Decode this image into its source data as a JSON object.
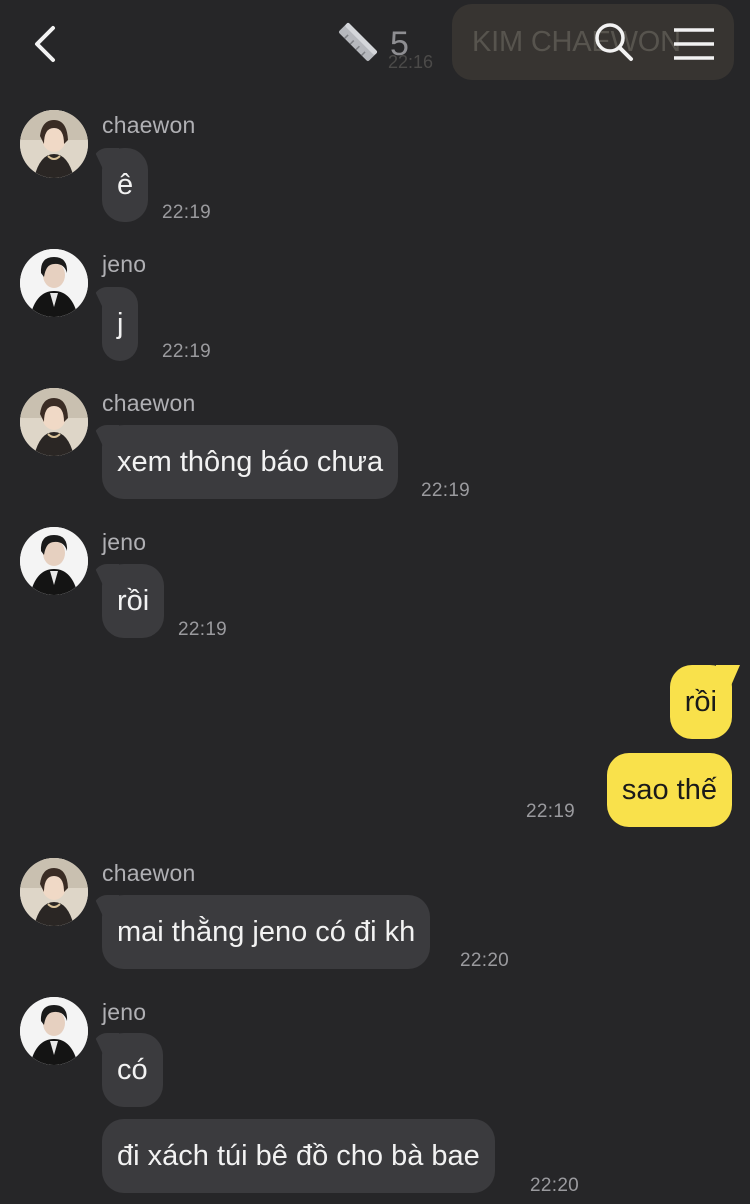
{
  "header": {
    "member_count": "5",
    "ghost_message": "KIM CHAEWON",
    "ghost_time": "22:16"
  },
  "messages": [
    {
      "sender": "chaewon",
      "text": "ê",
      "time": "22:19"
    },
    {
      "sender": "jeno",
      "text": "j",
      "time": "22:19"
    },
    {
      "sender": "chaewon",
      "text": "xem thông báo chưa",
      "time": "22:19"
    },
    {
      "sender": "jeno",
      "text": "rồi",
      "time": "22:19"
    },
    {
      "sender": "me",
      "text": "rồi",
      "time": ""
    },
    {
      "sender": "me",
      "text": "sao thế",
      "time": "22:19"
    },
    {
      "sender": "chaewon",
      "text": "mai thằng jeno có đi kh",
      "time": "22:20"
    },
    {
      "sender": "jeno",
      "text": "có",
      "time": ""
    },
    {
      "sender": "jeno",
      "text": "đi xách túi bê đồ cho bà bae",
      "time": "22:20"
    }
  ],
  "icons": {
    "back": "chevron-left-icon",
    "members": "ruler-icon",
    "search": "search-icon",
    "menu": "hamburger-icon"
  },
  "colors": {
    "background": "#262628",
    "incoming_bubble": "#3b3b3e",
    "outgoing_bubble": "#f9e14b"
  }
}
